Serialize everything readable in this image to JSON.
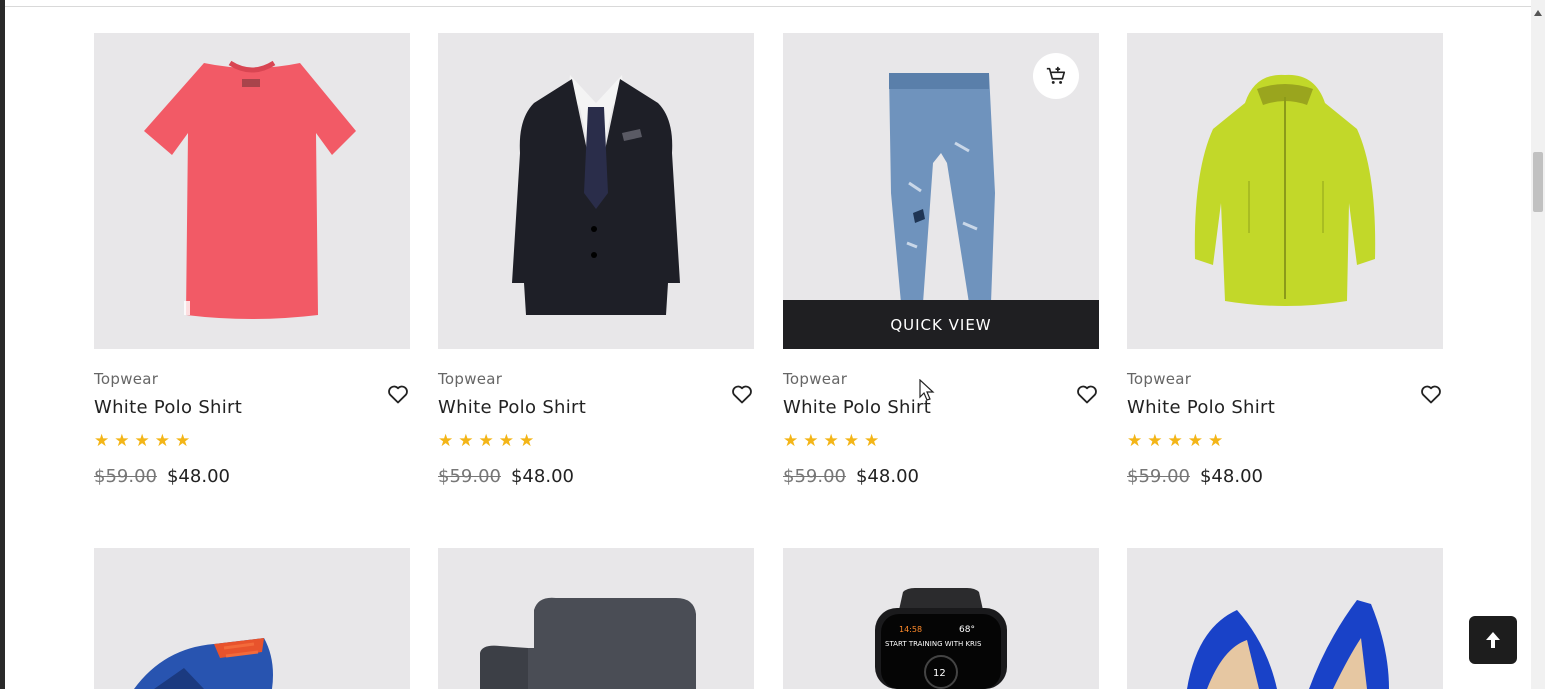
{
  "products": [
    {
      "category": "Topwear",
      "name": "White Polo Shirt",
      "old_price": "$59.00",
      "price": "$48.00",
      "stars": "★★★★★",
      "rating": 5,
      "image": "red-tshirt"
    },
    {
      "category": "Topwear",
      "name": "White Polo Shirt",
      "old_price": "$59.00",
      "price": "$48.00",
      "stars": "★★★★★",
      "rating": 5,
      "image": "black-blazer"
    },
    {
      "category": "Topwear",
      "name": "White Polo Shirt",
      "old_price": "$59.00",
      "price": "$48.00",
      "stars": "★★★★★",
      "rating": 5,
      "image": "blue-jeans"
    },
    {
      "category": "Topwear",
      "name": "White Polo Shirt",
      "old_price": "$59.00",
      "price": "$48.00",
      "stars": "★★★★★",
      "rating": 5,
      "image": "lime-jacket"
    }
  ],
  "hover_card": {
    "quick_view_label": "QUICK VIEW",
    "cart_icon": "add-to-cart-icon"
  },
  "second_row": [
    {
      "image": "sneaker"
    },
    {
      "image": "armchair"
    },
    {
      "image": "smartwatch"
    },
    {
      "image": "blue-heels"
    }
  ],
  "watch_face": {
    "top_left": "14:58",
    "top_right": "68°",
    "band": "START TRAINING WITH KRIS",
    "number": "12"
  },
  "back_to_top": {
    "icon": "arrow-up-icon"
  },
  "colors": {
    "star": "#f3b517",
    "card_bg": "#e8e7e9",
    "dark": "#1f1f22"
  }
}
